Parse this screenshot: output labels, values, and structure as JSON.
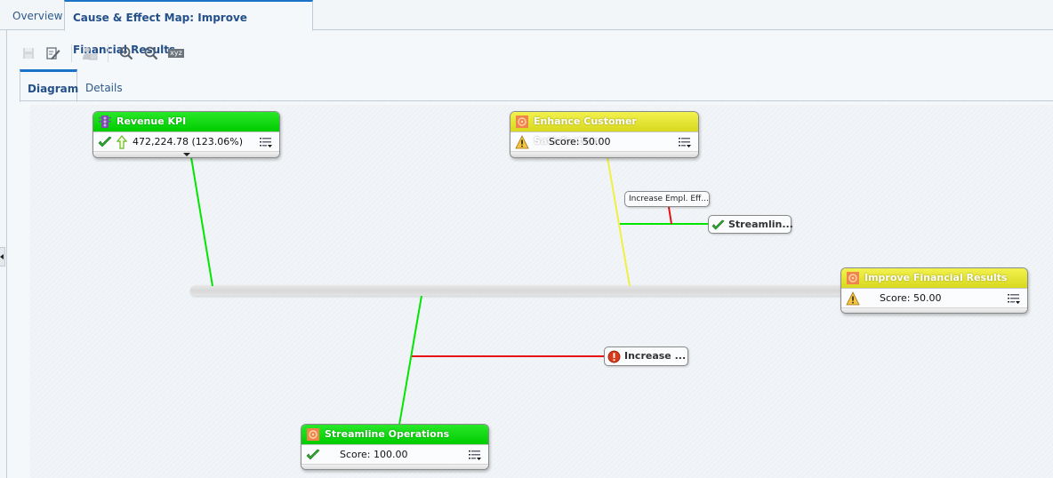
{
  "top_tabs": [
    {
      "label": "Overview",
      "selected": false
    },
    {
      "label": "Cause & Effect Map: Improve Financial Results",
      "selected": true
    }
  ],
  "toolbar": {
    "buttons": [
      {
        "name": "save",
        "icon": "save-icon",
        "enabled": false
      },
      {
        "name": "edit-properties",
        "icon": "edit-icon",
        "enabled": true
      },
      {
        "name": "send-email",
        "icon": "user-mail-icon",
        "enabled": false
      },
      {
        "name": "zoom-in",
        "icon": "zoom-in-icon",
        "enabled": true
      },
      {
        "name": "zoom-out",
        "icon": "zoom-out-icon",
        "enabled": true
      },
      {
        "name": "xyz",
        "icon": "xyz-icon",
        "label": "xyz",
        "enabled": true
      }
    ]
  },
  "sub_tabs": [
    {
      "label": "Diagram",
      "selected": true
    },
    {
      "label": "Details",
      "selected": false
    }
  ],
  "diagram": {
    "nodes": {
      "revenue_kpi": {
        "title": "Revenue KPI",
        "value": "472,224.78 (123.06%)",
        "status": "ok",
        "trend": "up",
        "header_color": "#00d400"
      },
      "enhance_customer": {
        "title": "Enhance Customer Satisfaction",
        "score": "Score: 50.00",
        "status": "warning",
        "header_color": "#e8e830"
      },
      "improve_financial": {
        "title": "Improve Financial Results",
        "score": "Score: 50.00",
        "status": "warning",
        "header_color": "#e8e830"
      },
      "streamline_operations": {
        "title": "Streamline Operations",
        "score": "Score: 100.00",
        "status": "ok",
        "header_color": "#00d400"
      }
    },
    "small_nodes": {
      "increase_empl": {
        "label": "Increase Empl. Eff..."
      },
      "streamline_small": {
        "label": "Streamlin...",
        "status": "ok"
      },
      "increase_small": {
        "label": "Increase ...",
        "status": "error"
      }
    },
    "colors": {
      "green_link": "#00e600",
      "yellow_link": "#f0f040",
      "red_link": "#e81010"
    }
  }
}
